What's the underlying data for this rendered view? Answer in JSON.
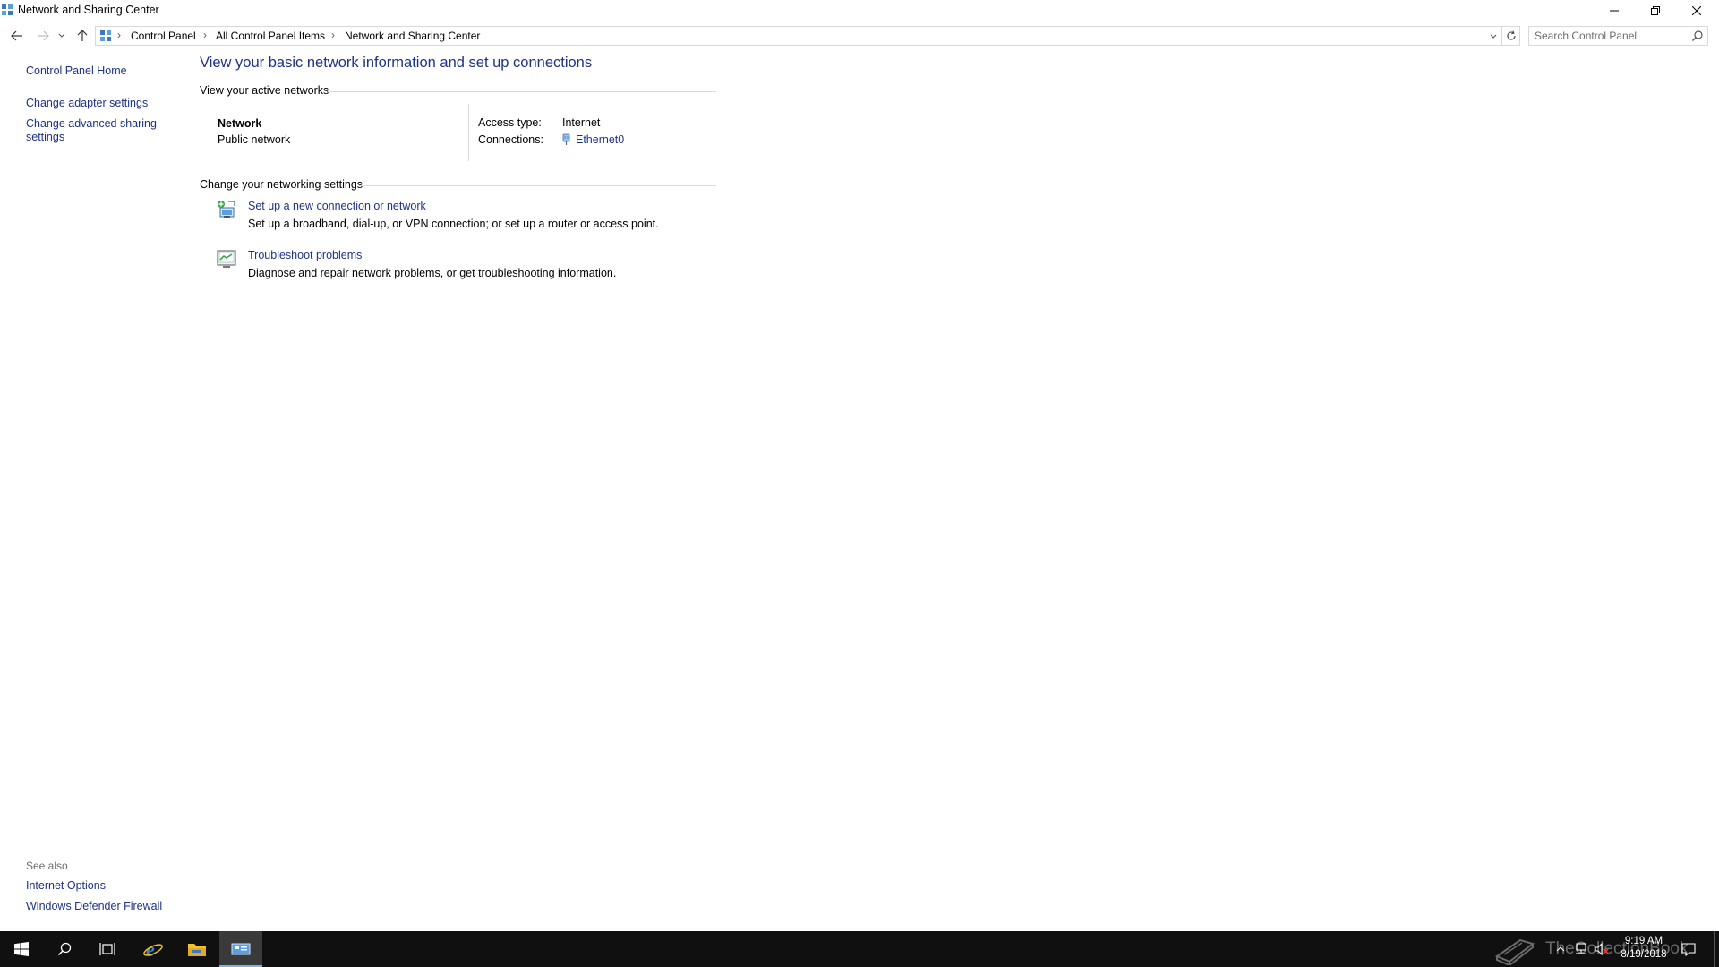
{
  "window": {
    "title": "Network and Sharing Center"
  },
  "breadcrumb": {
    "items": [
      "Control Panel",
      "All Control Panel Items",
      "Network and Sharing Center"
    ],
    "separator": "›"
  },
  "search": {
    "placeholder": "Search Control Panel"
  },
  "sidebar": {
    "links": {
      "home": "Control Panel Home",
      "adapter": "Change adapter settings",
      "advanced": "Change advanced sharing settings"
    },
    "see_also": {
      "label": "See also",
      "items": [
        "Internet Options",
        "Windows Defender Firewall"
      ]
    }
  },
  "main": {
    "title": "View your basic network information and set up connections",
    "active_networks": {
      "heading": "View your active networks",
      "network_name": "Network",
      "network_category": "Public network",
      "access_type_label": "Access type:",
      "access_type_value": "Internet",
      "connections_label": "Connections:",
      "connection_name": "Ethernet0"
    },
    "settings": {
      "heading": "Change your networking settings",
      "tasks": [
        {
          "title": "Set up a new connection or network",
          "description": "Set up a broadband, dial-up, or VPN connection; or set up a router or access point.",
          "icon": "new-connection-icon"
        },
        {
          "title": "Troubleshoot problems",
          "description": "Diagnose and repair network problems, or get troubleshooting information.",
          "icon": "troubleshoot-icon"
        }
      ]
    }
  },
  "taskbar": {
    "pinned": [
      "start-icon",
      "search-icon",
      "task-view-icon",
      "internet-explorer-icon",
      "file-explorer-icon",
      "network-center-icon"
    ],
    "watermark": "TheCollectionBook",
    "clock": {
      "time": "9:19 AM",
      "date": "8/19/2018"
    }
  },
  "colors": {
    "link": "#1e3287",
    "taskbar": "#101010"
  }
}
